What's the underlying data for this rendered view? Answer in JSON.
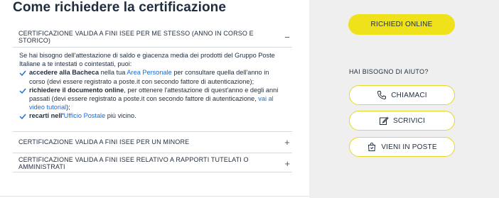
{
  "page": {
    "title": "Come richiedere la certificazione"
  },
  "accordion": [
    {
      "title": "CERTIFICAZIONE VALIDA A FINI ISEE PER ME STESSO (ANNO IN CORSO E STORICO)",
      "toggle": "−",
      "intro": "Se hai bisogno dell'attestazione di saldo e giacenza media dei prodotti del Gruppo Poste Italiane a te intestati o cointestati, puoi:",
      "items": [
        {
          "bold": "accedere alla Bacheca",
          "pre_link": " nella tua ",
          "link": "Area Personale",
          "post_link": " per consultare quella dell'anno in corso (devi essere registrato a poste.it con secondo fattore di autenticazione);"
        },
        {
          "bold": "richiedere il documento online",
          "pre_link": ", per ottenere l'attestazione di quest'anno e degli anni passati (devi essere registrato a poste.it con secondo fattore di autenticazione, ",
          "link": "vai al video tutorial",
          "post_link": ");"
        },
        {
          "bold": "recarti nell'",
          "pre_link": "",
          "link": "Ufficio Postale",
          "post_link": "  più vicino."
        }
      ]
    },
    {
      "title": "CERTIFICAZIONE VALIDA A FINI ISEE PER UN MINORE",
      "toggle": "+"
    },
    {
      "title": "CERTIFICAZIONE VALIDA A FINI ISEE RELATIVO A RAPPORTI TUTELATI O AMMINISTRATI",
      "toggle": "+"
    }
  ],
  "aside": {
    "cta": "RICHIEDI ONLINE",
    "help_title": "HAI BISOGNO DI AIUTO?",
    "buttons": [
      {
        "label": "CHIAMACI",
        "icon": "phone-icon"
      },
      {
        "label": "SCRIVICI",
        "icon": "write-icon"
      },
      {
        "label": "VIENI IN POSTE",
        "icon": "shopping-bag-icon"
      }
    ]
  },
  "colors": {
    "accent": "#efe21a",
    "link": "#1b6bd6",
    "text": "#1f2d3d",
    "sidebar_bg": "#efefef"
  }
}
